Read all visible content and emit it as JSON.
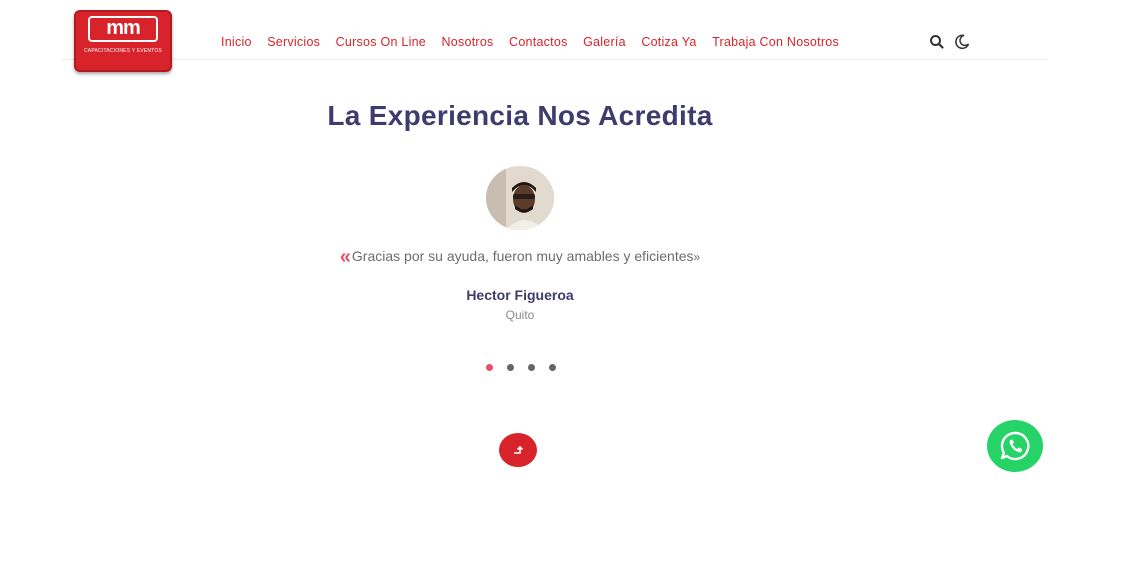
{
  "brand": {
    "logo_text": "mm",
    "logo_subtext": "CAPACITACIONES Y EVENTOS",
    "color_primary": "#d8232a",
    "color_accent": "#e84f6a",
    "color_heading": "#3d3c6d"
  },
  "nav": {
    "items": [
      {
        "label": "Inicio"
      },
      {
        "label": "Servicios"
      },
      {
        "label": "Cursos On Line"
      },
      {
        "label": "Nosotros"
      },
      {
        "label": "Contactos"
      },
      {
        "label": "Galería"
      },
      {
        "label": "Cotiza Ya"
      },
      {
        "label": "Trabaja Con Nosotros"
      }
    ],
    "icons": [
      "search-icon",
      "moon-icon"
    ]
  },
  "testimonials": {
    "title": "La Experiencia Nos Acredita",
    "quote_open": "«",
    "quote_text": "Gracias por su ayuda, fueron muy amables y eficientes",
    "quote_close": "»",
    "person_name": "Hector Figueroa",
    "person_city": "Quito",
    "slides_total": 4,
    "active_slide": 1
  },
  "floating": {
    "back_to_top_icon": "arrow-up-icon",
    "whatsapp_icon": "whatsapp-icon",
    "whatsapp_color": "#25d366"
  }
}
